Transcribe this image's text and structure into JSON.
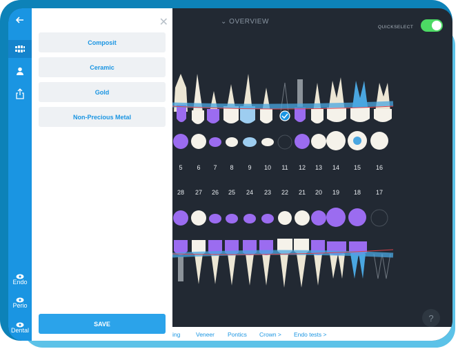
{
  "rail": {
    "icons": [
      "arrow-left-icon",
      "teeth-chart-icon",
      "user-icon",
      "share-icon"
    ],
    "views": [
      {
        "label": "Endo",
        "icon": "eye-icon"
      },
      {
        "label": "Perio",
        "icon": "eye-icon"
      },
      {
        "label": "Dental",
        "icon": "eye-icon"
      }
    ]
  },
  "panel": {
    "close_icon": "close-icon",
    "options": [
      "Composit",
      "Ceramic",
      "Gold",
      "Non-Precious Metal"
    ],
    "save_label": "SAVE"
  },
  "header": {
    "title": "OVERVIEW",
    "quickselect_label": "QUICKSELECT",
    "quickselect_on": true
  },
  "chart": {
    "upper_numbers": [
      "5",
      "6",
      "7",
      "8",
      "9",
      "10",
      "11",
      "12",
      "13",
      "14",
      "15",
      "16"
    ],
    "lower_numbers": [
      "28",
      "27",
      "26",
      "25",
      "24",
      "23",
      "22",
      "21",
      "20",
      "19",
      "18",
      "17"
    ],
    "selected_tooth": "11",
    "colors": {
      "purple": "#9b6cf0",
      "blue_band": "#4aa6e0",
      "gum_line": "#e0424a",
      "enamel": "#f2ede0"
    }
  },
  "bottom_tabs": [
    "ing",
    "Veneer",
    "Pontics",
    "Crown >",
    "Endo tests >"
  ],
  "help_label": "?"
}
